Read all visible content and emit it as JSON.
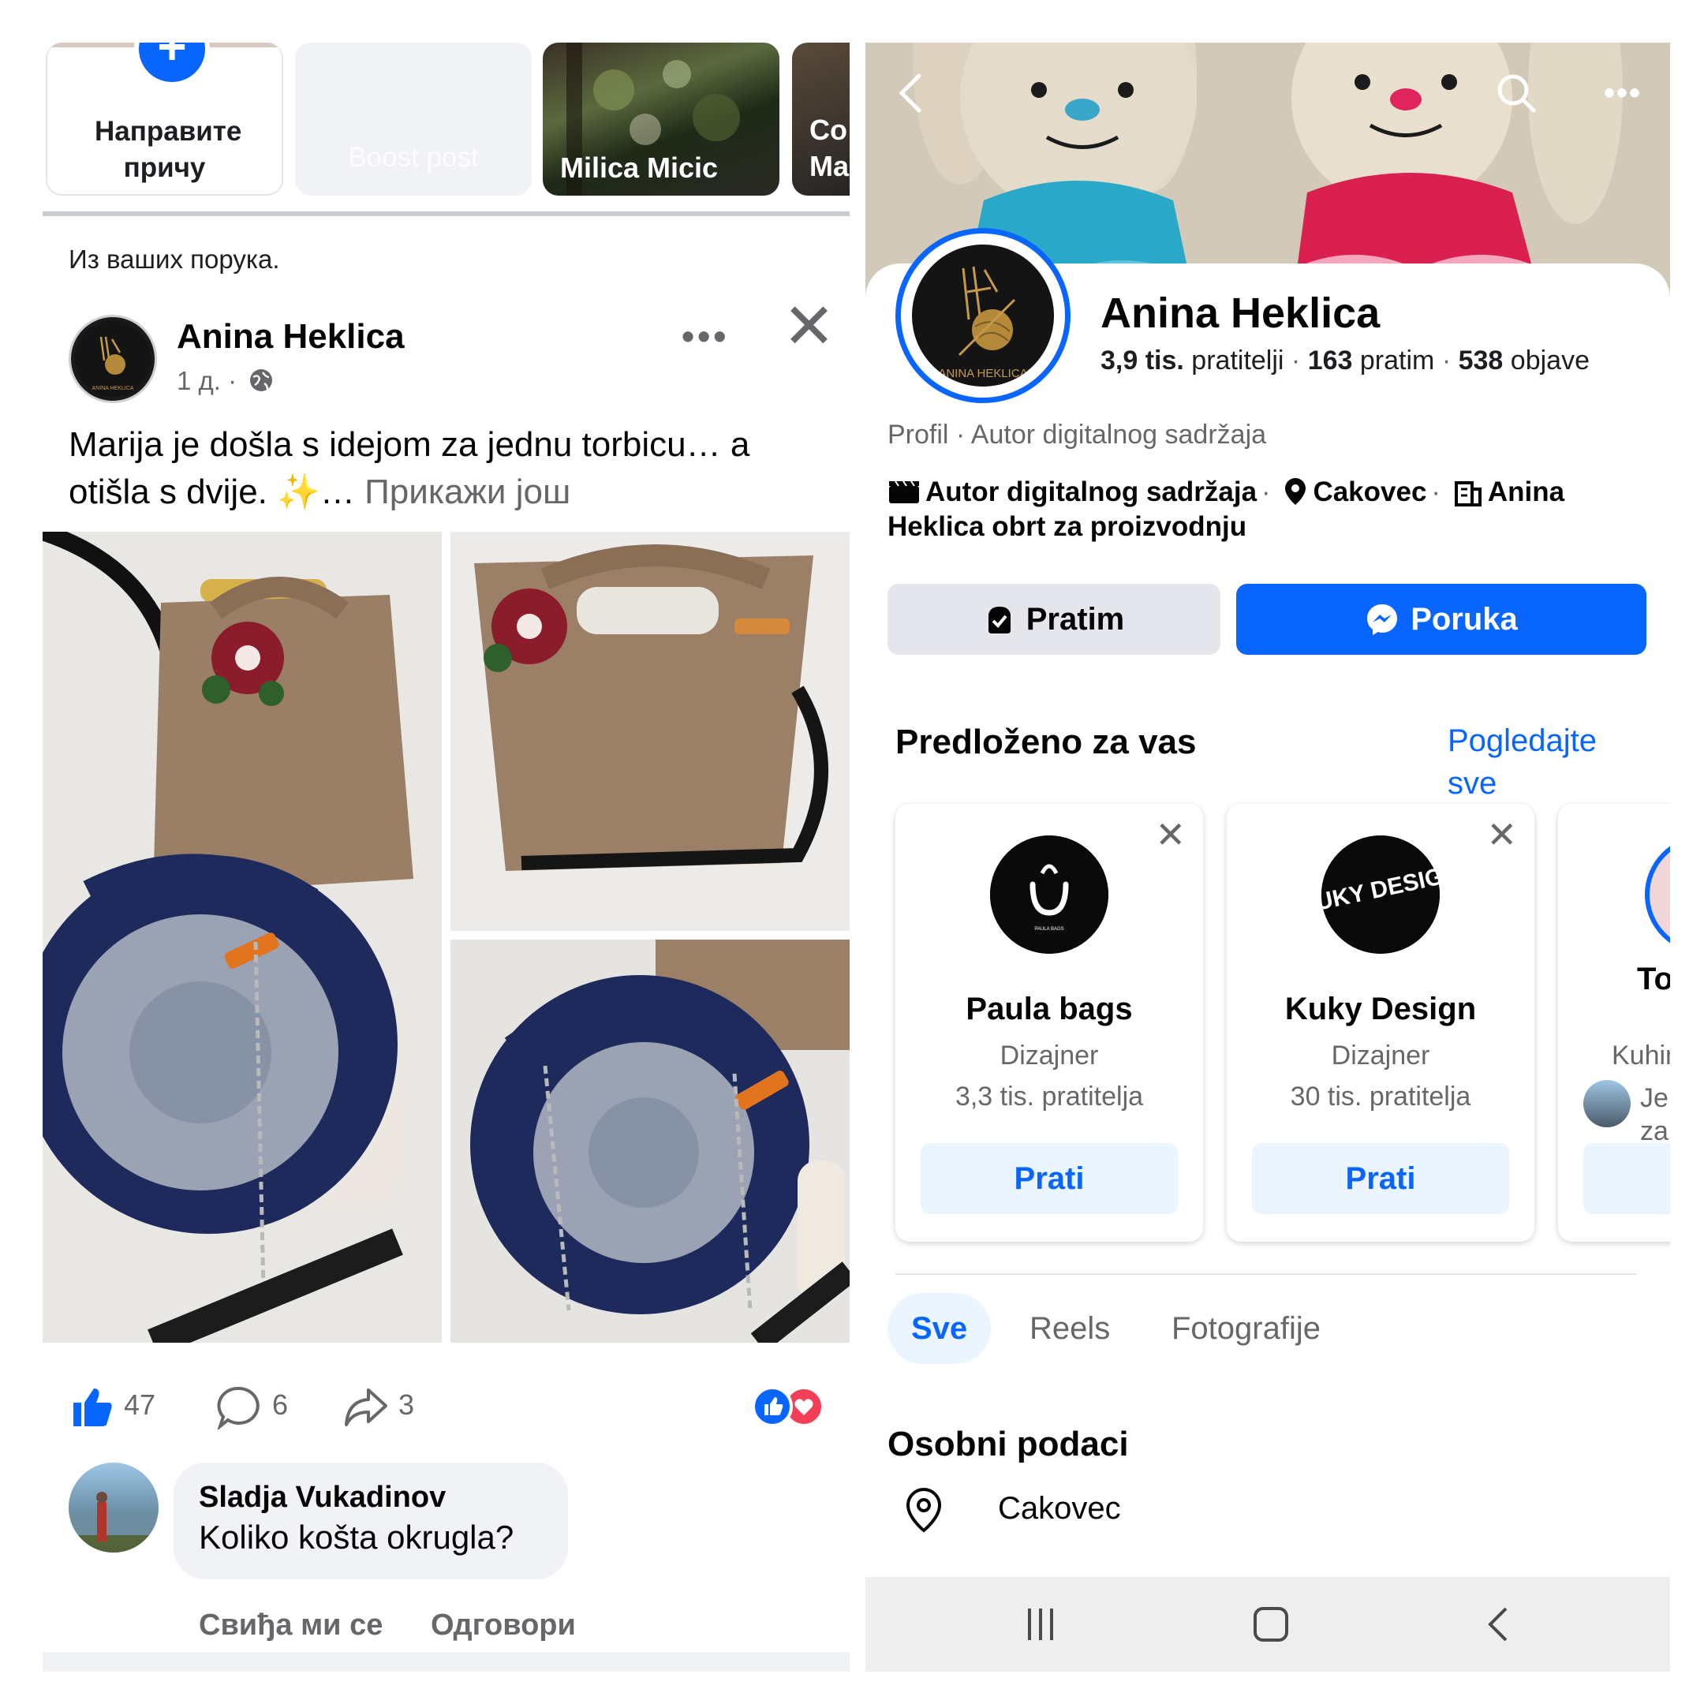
{
  "left_panel": {
    "stories": {
      "create_label": "Направите причу",
      "boost_label": "Boost post",
      "milica_label": "Milica Micic",
      "partial_label": "Co Ma"
    },
    "from_groups": "Из ваших порука.",
    "post": {
      "author": "Anina Heklica",
      "time": "1 д. ·",
      "text": "Marija je došla s idejom za jednu torbicu… a otišla s dvije. ✨…",
      "see_more": "Прикажи још",
      "likes": "47",
      "comments": "6",
      "shares": "3"
    },
    "comment": {
      "author": "Sladja Vukadinov",
      "text": "Koliko košta okrugla?",
      "like_action": "Свиђа ми се",
      "reply_action": "Одговори"
    }
  },
  "right_panel": {
    "profile": {
      "name": "Anina Heklica",
      "followers_count": "3,9 tis.",
      "followers_label": "pratitelji",
      "following_count": "163",
      "following_label": "pratim",
      "posts_count": "538",
      "posts_label": "objave",
      "category_line": "Profil · Autor digitalnog sadržaja",
      "detail_creator": "Autor digitalnog sadržaja",
      "detail_city": "Cakovec",
      "detail_business": "Anina Heklica obrt za proizvodnju"
    },
    "buttons": {
      "following": "Pratim",
      "message": "Poruka"
    },
    "suggestions": {
      "title": "Predloženo za vas",
      "see_all": "Pogledajte sve",
      "cards": [
        {
          "name": "Paula bags",
          "category": "Dizajner",
          "followers": "3,3 tis. pratitelja",
          "button": "Prati",
          "logo_text": "PAULA BAGS"
        },
        {
          "name": "Kuky Design",
          "category": "Dizajner",
          "followers": "30 tis. pratitelja",
          "button": "Prati",
          "logo_text": "KUKY DESIGN"
        },
        {
          "name": "To",
          "category": "Kuhin",
          "followers": "Je zai",
          "button": ""
        }
      ]
    },
    "tabs": [
      "Sve",
      "Reels",
      "Fotografije"
    ],
    "personal_info": {
      "title": "Osobni podaci",
      "city": "Cakovec"
    }
  },
  "colors": {
    "accent": "#0866ff",
    "secondary_text": "#65676b",
    "button_grey": "#e4e6eb",
    "like_blue": "#0866ff",
    "love_red": "#f33e58"
  },
  "icons": [
    "plus-icon",
    "globe-icon",
    "more-icon",
    "close-icon",
    "like-icon",
    "comment-icon",
    "share-icon",
    "back-icon",
    "search-icon",
    "clapper-icon",
    "location-icon",
    "building-icon",
    "following-icon",
    "messenger-icon"
  ]
}
